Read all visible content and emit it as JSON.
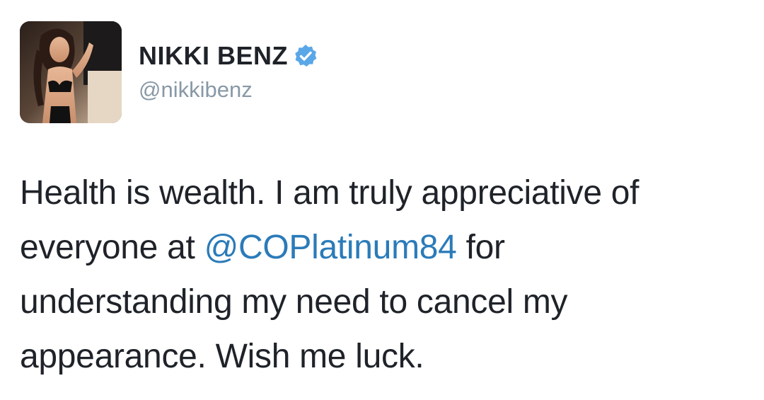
{
  "user": {
    "display_name": "NIKKI BENZ",
    "handle": "@nikkibenz",
    "verified": true,
    "avatar_icon": "profile-photo"
  },
  "tweet": {
    "line1": "Health is wealth. I am truly appreciative of",
    "line2_pre": "everyone at ",
    "mention": "@COPlatinum84",
    "line2_post": " for",
    "line3": "understanding my need to cancel my",
    "line4": "appearance. Wish me luck."
  },
  "colors": {
    "text": "#1f2329",
    "handle": "#8899a6",
    "mention": "#2b7bb9",
    "verified": "#5aa7e8"
  }
}
